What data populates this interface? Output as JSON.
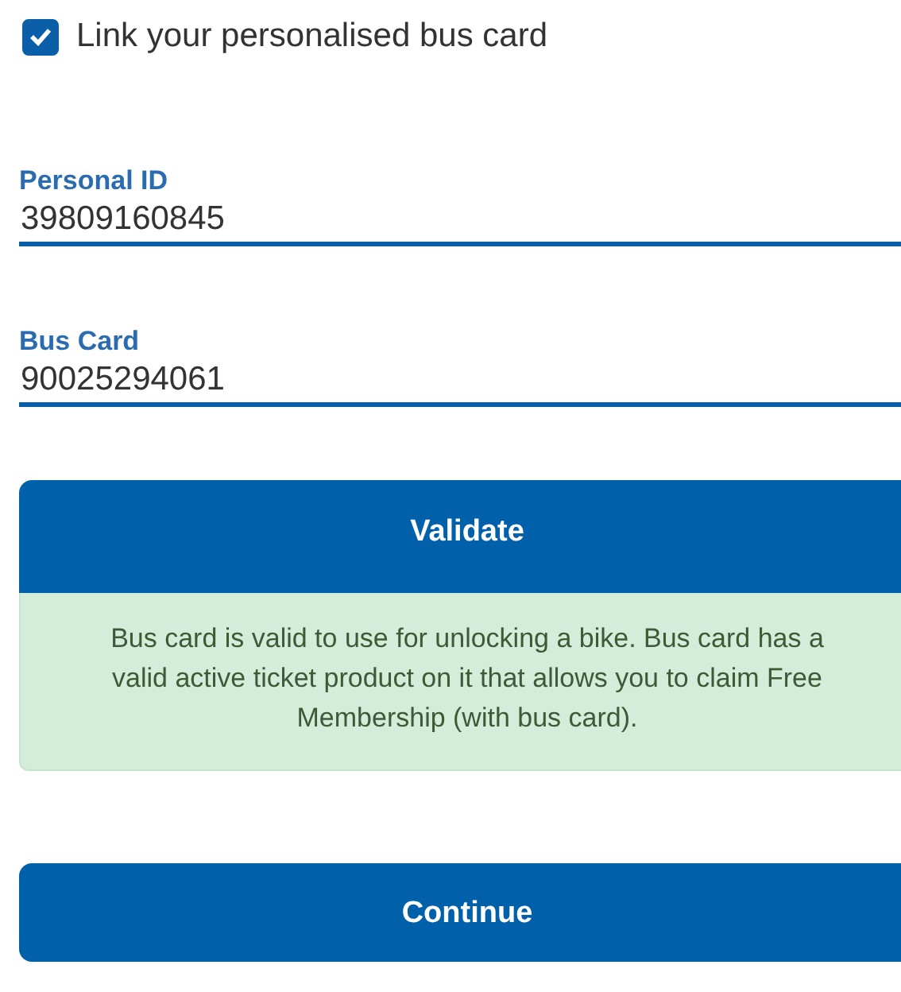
{
  "link_card": {
    "label": "Link your personalised bus card",
    "checked": true
  },
  "fields": [
    {
      "label": "Personal ID",
      "value": "39809160845"
    },
    {
      "label": "Bus Card",
      "value": "90025294061"
    }
  ],
  "validate_button": "Validate",
  "alert": {
    "kind": "success",
    "text": "Bus card is valid to use for unlocking a bike. Bus card has a valid active ticket product on it that allows you to claim Free Membership (with bus card)."
  },
  "continue_button": "Continue"
}
